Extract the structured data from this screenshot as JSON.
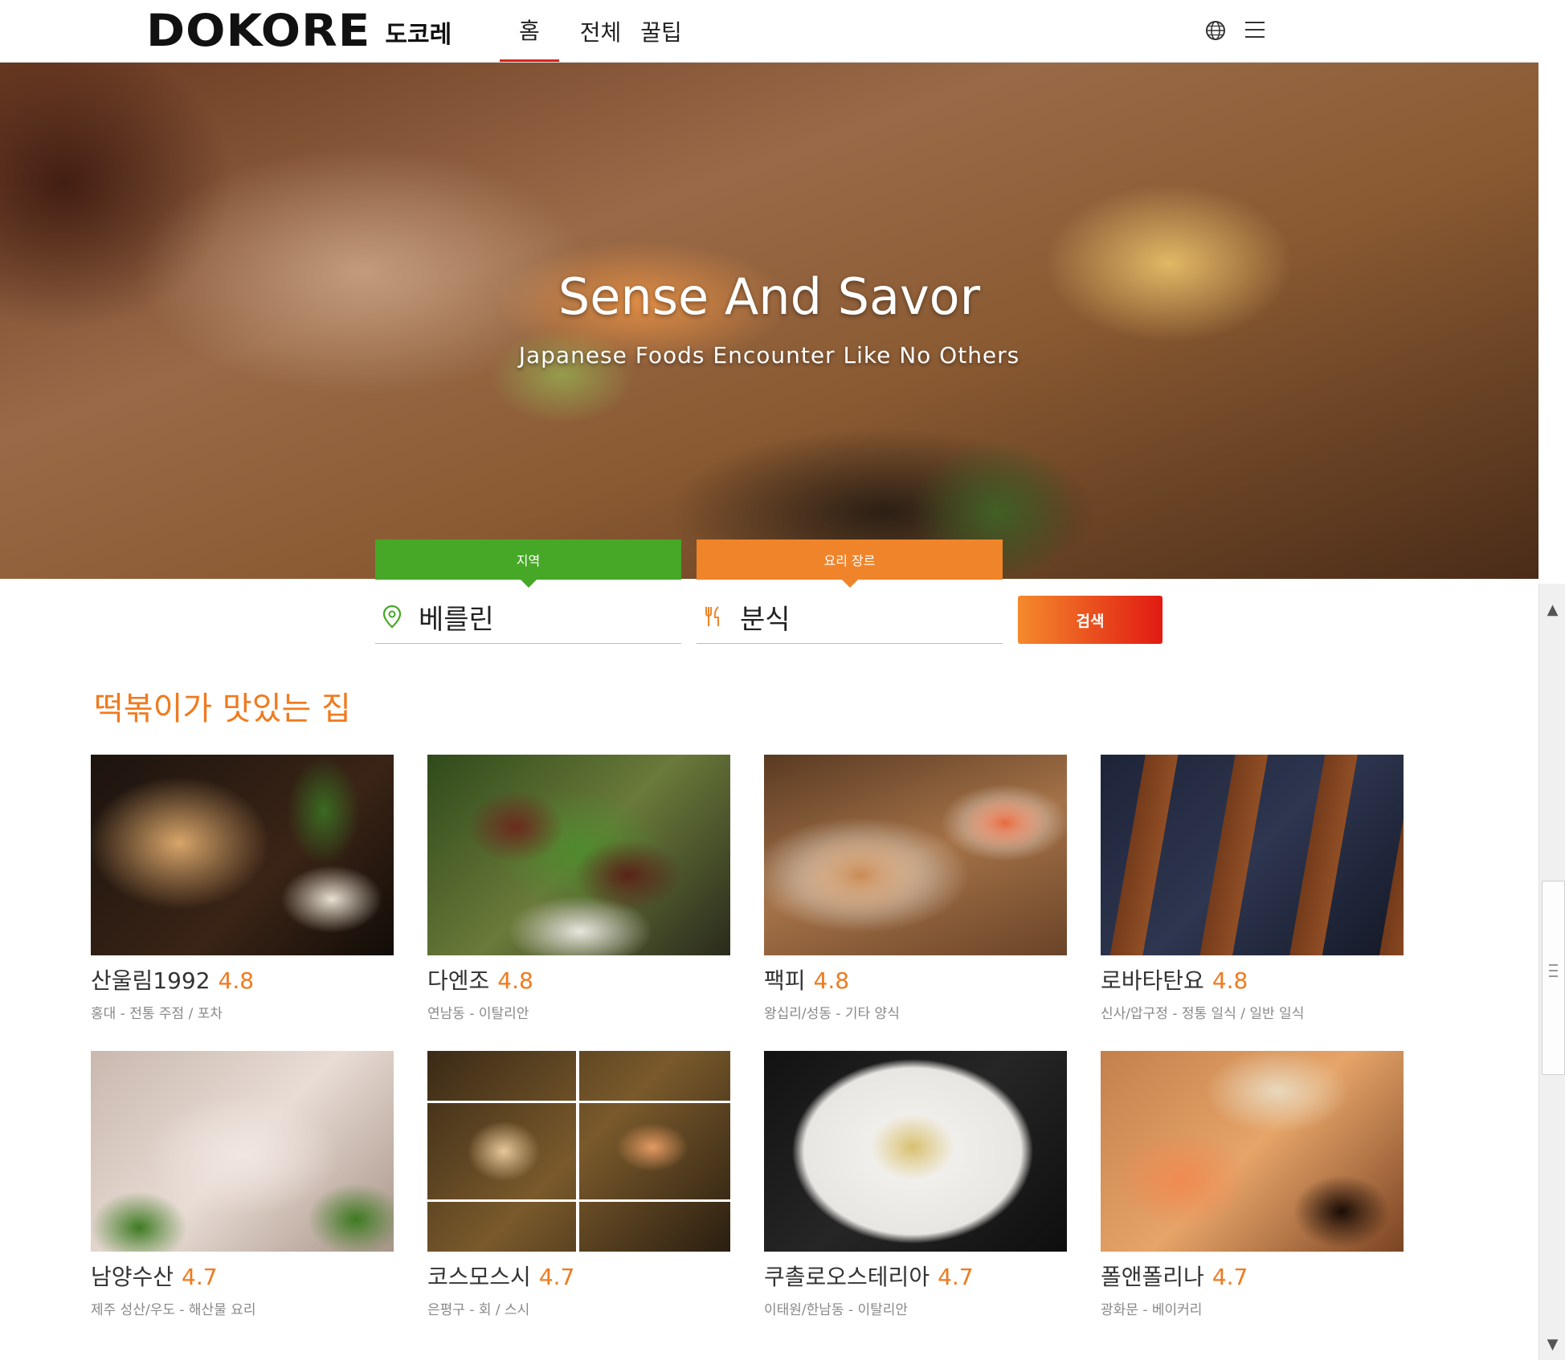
{
  "header": {
    "logo_en": "DOKORE",
    "logo_ko": "도코레",
    "nav": [
      {
        "label": "홈",
        "active": true
      },
      {
        "label": "전체",
        "active": false
      },
      {
        "label": "꿀팁",
        "active": false
      }
    ]
  },
  "hero": {
    "title": "Sense And Savor",
    "subtitle": "Japanese Foods Encounter Like No Others"
  },
  "search": {
    "area_tab": "지역",
    "genre_tab": "요리 장르",
    "area_value": "베를린",
    "genre_value": "분식",
    "button": "검색"
  },
  "section": {
    "title": "떡볶이가 맛있는 집"
  },
  "restaurants": [
    {
      "name": "산울림1992",
      "rating": "4.8",
      "meta": "홍대 - 전통 주점 / 포차"
    },
    {
      "name": "다엔조",
      "rating": "4.8",
      "meta": "연남동 - 이탈리안"
    },
    {
      "name": "팩피",
      "rating": "4.8",
      "meta": "왕십리/성동 - 기타 양식"
    },
    {
      "name": "로바타탄요",
      "rating": "4.8",
      "meta": "신사/압구정 - 정통 일식 / 일반 일식"
    },
    {
      "name": "남양수산",
      "rating": "4.7",
      "meta": "제주 성산/우도 - 해산물 요리"
    },
    {
      "name": "코스모스시",
      "rating": "4.7",
      "meta": "은평구 - 회 / 스시"
    },
    {
      "name": "쿠촐로오스테리아",
      "rating": "4.7",
      "meta": "이태원/한남동 - 이탈리안"
    },
    {
      "name": "폴앤폴리나",
      "rating": "4.7",
      "meta": "광화문 - 베이커리"
    }
  ],
  "colors": {
    "accent_orange": "#f07a1e",
    "nav_active_red": "#d9261c",
    "area_green": "#47a827",
    "genre_orange": "#f0842a"
  },
  "icons": [
    "globe-icon",
    "hamburger-menu-icon",
    "location-pin-icon",
    "fork-knife-icon"
  ]
}
